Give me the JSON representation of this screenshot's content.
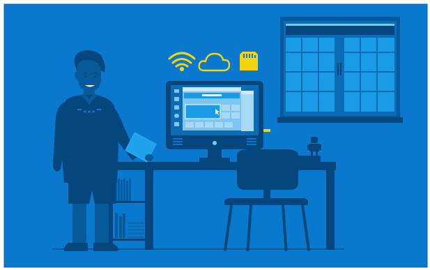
{
  "scene": {
    "description_free": true,
    "colors": {
      "frame": "#ffffff",
      "background": "#0a78cc",
      "border": "#0d5fa8",
      "silhouette": "#075a9a",
      "silhouette_dark": "#05467c",
      "accent_yellow": "#f5d30f",
      "screen_light": "#7ec6ef",
      "window_pane": "#1a9be6",
      "window_pane_light": "#25a8ef",
      "white": "#ffffff"
    },
    "icons": [
      "wifi-icon",
      "cloud-icon",
      "sd-card-icon"
    ]
  }
}
